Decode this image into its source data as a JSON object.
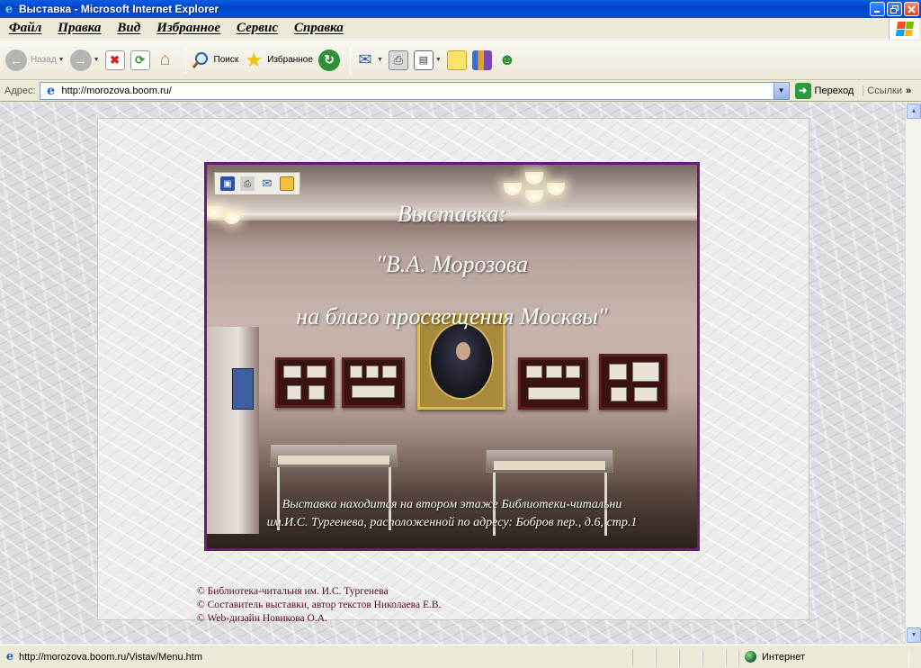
{
  "window": {
    "title": "Выставка - Microsoft Internet Explorer",
    "app_icon_glyph": "e"
  },
  "menu": {
    "items": [
      "Файл",
      "Правка",
      "Вид",
      "Избранное",
      "Сервис",
      "Справка"
    ]
  },
  "toolbar": {
    "back_label": "Назад",
    "search_label": "Поиск",
    "favorites_label": "Избранное"
  },
  "address": {
    "label": "Адрес:",
    "url": "http://morozova.boom.ru/",
    "go_label": "Переход",
    "links_label": "Ссылки",
    "more": "»"
  },
  "page": {
    "title_line1": "Выставка:",
    "title_line2": "\"В.А. Морозова",
    "title_line3": "на благо просвещения Москвы\"",
    "note_line1": "Выставка находится на втором этаже  Библиотеки-читальни",
    "note_line2": "им.И.С. Тургенева, расположенной по адресу: Бобров пер., д.6, стр.1",
    "credits": [
      "© Библиотека-читальня им. И.С. Тургенева",
      "© Составитель выставки, автор текстов Николаева Е.В.",
      "© Web-дизайн Новикова О.А."
    ]
  },
  "status": {
    "text": "http://morozova.boom.ru/Vistav/Menu.htm",
    "zone": "Интернет"
  },
  "colors": {
    "titlebar": "#0a5ee0",
    "photo_border": "#6a1a78",
    "credits_text": "#5a0a24"
  }
}
